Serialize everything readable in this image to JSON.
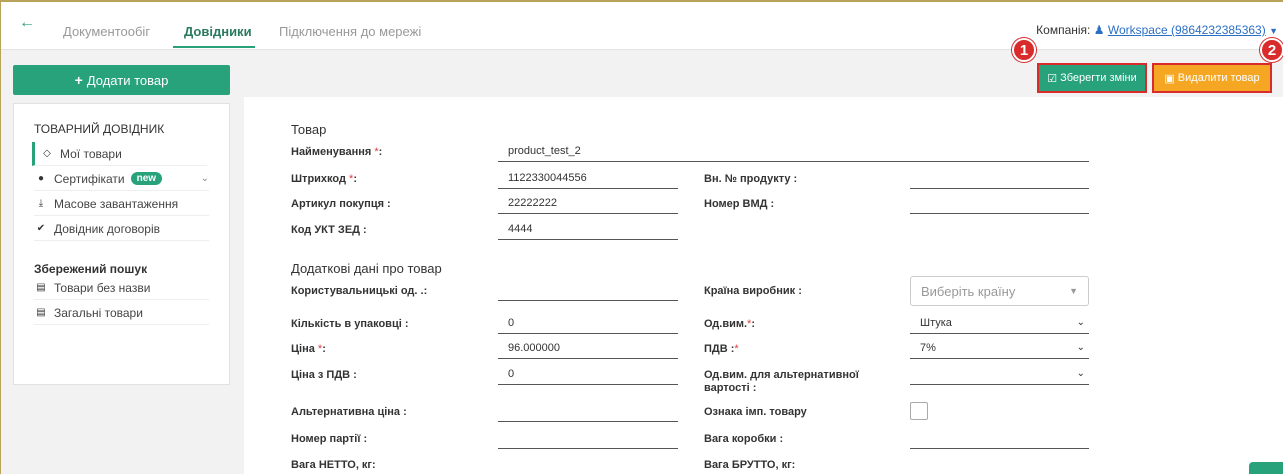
{
  "nav": {
    "back_icon": "arrow-left-icon",
    "tabs": [
      "Документообіг",
      "Довідники",
      "Підключення до мережі"
    ],
    "company_label": "Компанія:",
    "company_value": "Workspace (9864232385363)"
  },
  "actions": {
    "add_label": "Додати товар",
    "save_label": "Зберегти зміни",
    "delete_label": "Видалити товар",
    "marker_1": "1",
    "marker_2": "2"
  },
  "sidebar": {
    "heading": "ТОВАРНИЙ ДОВІДНИК",
    "items": [
      {
        "label": "Мої товари",
        "icon": "cube-icon"
      },
      {
        "label": "Сертифікати",
        "icon": "circle-icon",
        "badge": "new"
      },
      {
        "label": "Масове завантаження",
        "icon": "download-icon"
      },
      {
        "label": "Довідник договорів",
        "icon": "check-icon"
      }
    ],
    "saved_heading": "Збережений пошук",
    "saved": [
      {
        "label": "Товари без назви",
        "icon": "file-icon"
      },
      {
        "label": "Загальні товари",
        "icon": "file-icon"
      }
    ]
  },
  "form": {
    "section1": "Товар",
    "name_label": "Найменування",
    "name_value": "product_test_2",
    "barcode_label": "Штрихкод",
    "barcode_value": "1122330044556",
    "internal_no_label": "Вн. № продукту :",
    "internal_no_value": "",
    "buyer_article_label": "Артикул покупця :",
    "buyer_article_value": "22222222",
    "vmd_label": "Номер ВМД :",
    "vmd_value": "",
    "ukt_label": "Код УКТ ЗЕД :",
    "ukt_value": "4444",
    "section2": "Додаткові дані про товар",
    "user_unit_label": "Користувальницькі од. .:",
    "user_unit_value": "",
    "country_label": "Країна виробник :",
    "country_placeholder": "Виберіть країну",
    "qty_pack_label": "Кількість в упаковці :",
    "qty_pack_value": "0",
    "unit_label": "Од.вим.",
    "unit_value": "Штука",
    "price_label": "Ціна",
    "price_value": "96.000000",
    "vat_label": "ПДВ :",
    "vat_value": "7%",
    "price_vat_label": "Ціна з ПДВ :",
    "price_vat_value": "0",
    "alt_unit_label_1": "Од.вим. для альтернативної",
    "alt_unit_label_2": "вартості :",
    "alt_unit_value": "",
    "alt_price_label": "Альтернативна ціна :",
    "alt_price_value": "",
    "imported_label": "Ознака імп. товару",
    "batch_label": "Номер партії :",
    "batch_value": "",
    "box_weight_label": "Вага коробки :",
    "box_weight_value": "",
    "net_weight_label": "Вага НЕТТО, кг:",
    "gross_weight_label": "Вага БРУТТО, кг:",
    "required_mark": "*"
  }
}
